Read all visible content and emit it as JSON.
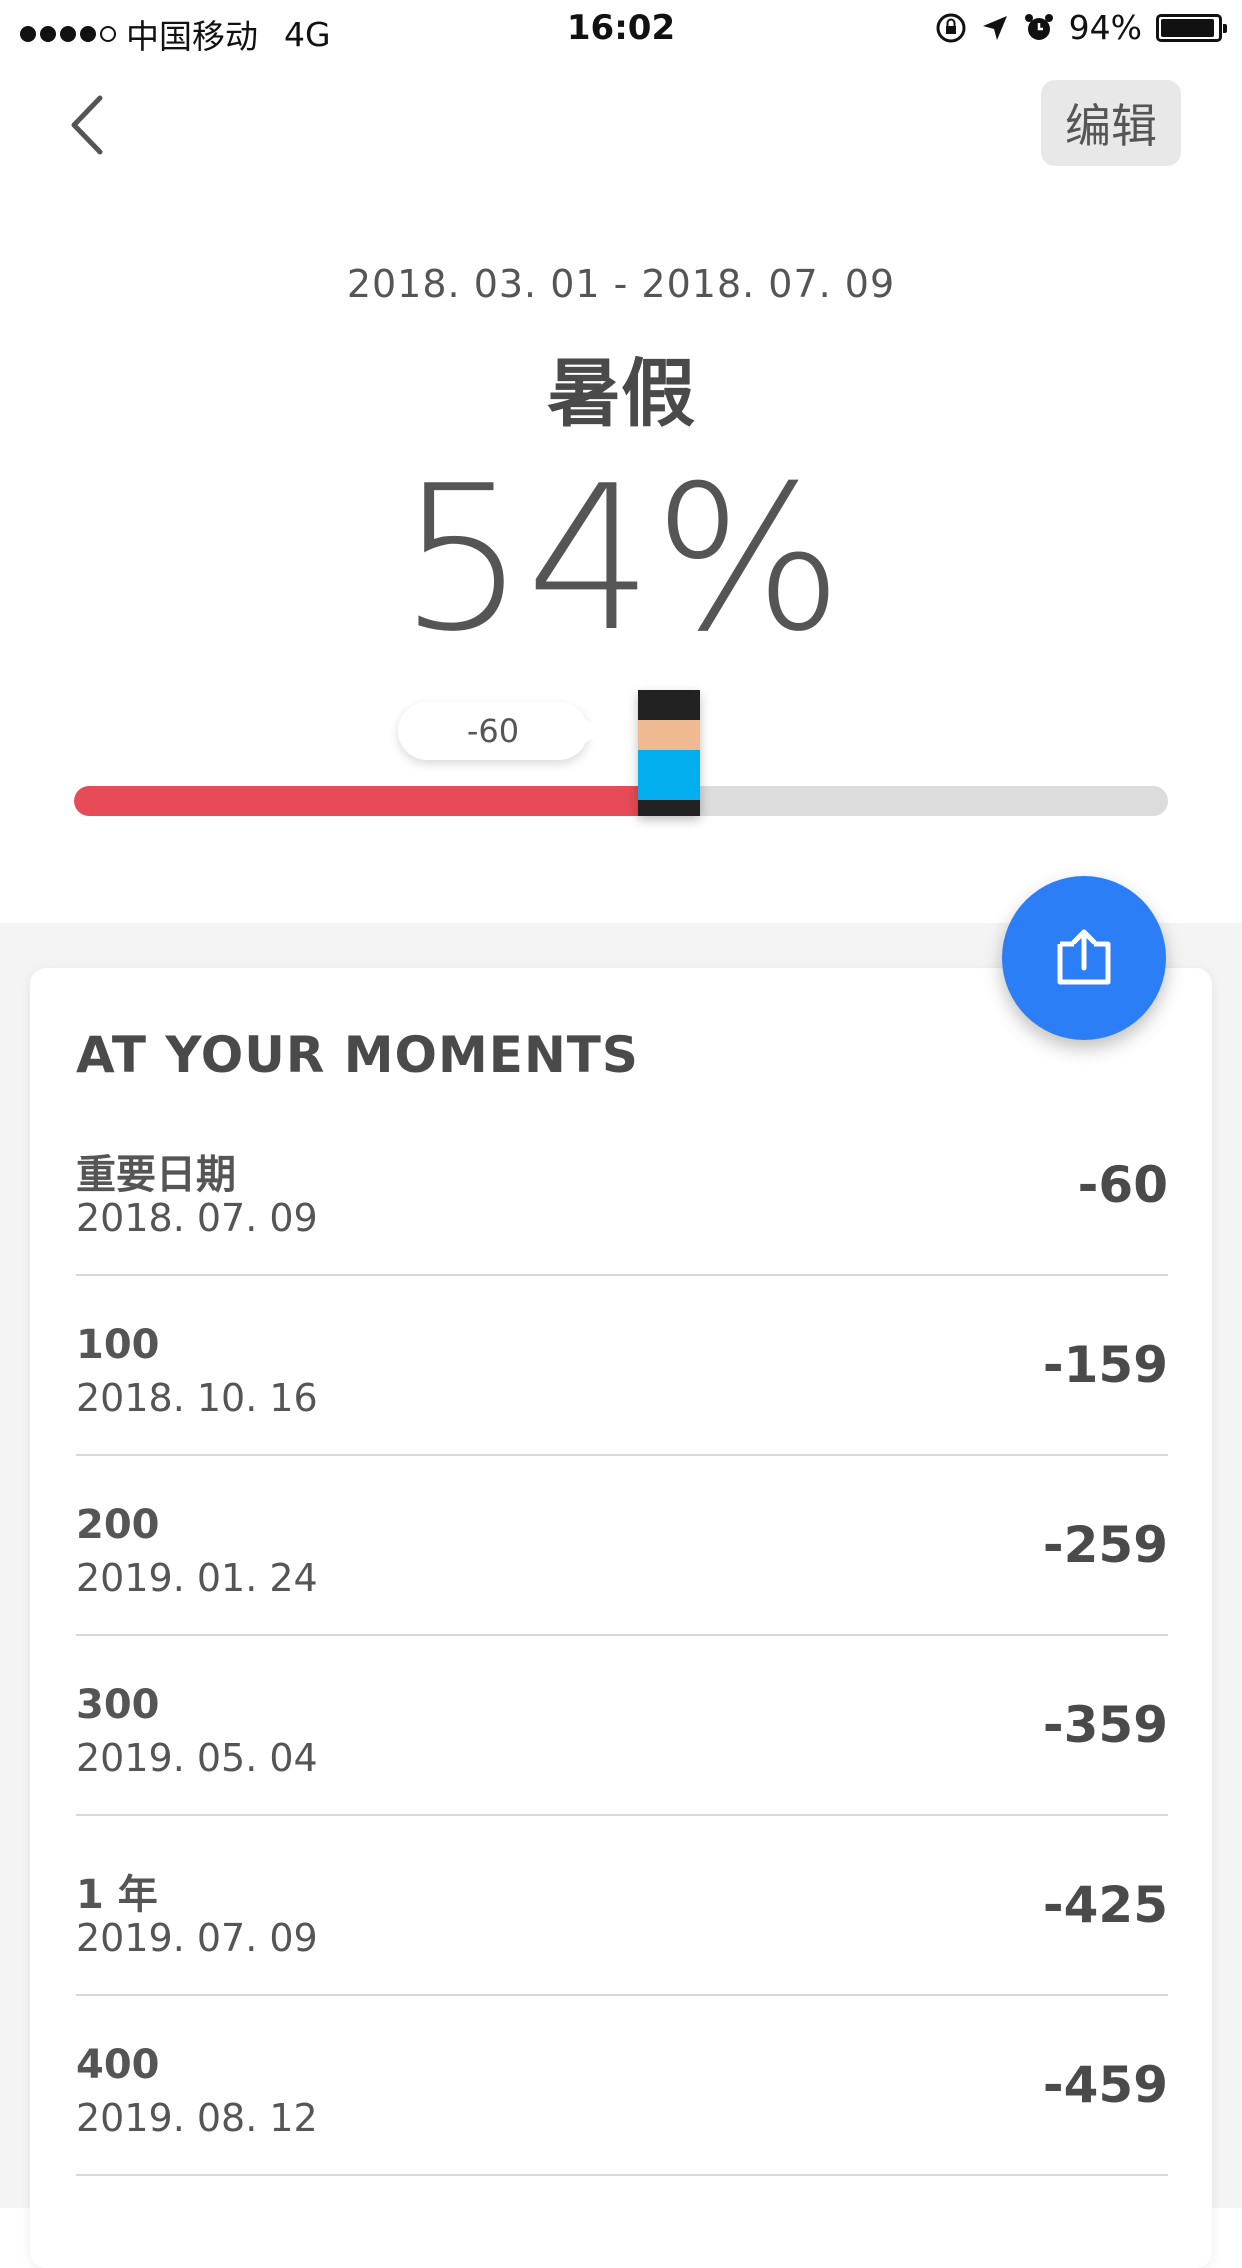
{
  "status_bar": {
    "carrier": "中国移动",
    "network": "4G",
    "time": "16:02",
    "battery": "94%"
  },
  "nav": {
    "back_icon": "chevron-left-icon",
    "edit_label": "编辑"
  },
  "header": {
    "date_range": "2018. 03. 01 - 2018. 07. 09",
    "title": "暑假",
    "percent": "54%"
  },
  "progress": {
    "value_percent": 54,
    "bubble_label": "-60",
    "fill_color": "#e74b58",
    "track_color": "#dcdcdc"
  },
  "moments": {
    "title": "AT YOUR MOMENTS",
    "items": [
      {
        "label": "重要日期",
        "date": "2018. 07. 09",
        "value": "-60"
      },
      {
        "label": "100",
        "date": "2018. 10. 16",
        "value": "-159"
      },
      {
        "label": "200",
        "date": "2019. 01. 24",
        "value": "-259"
      },
      {
        "label": "300",
        "date": "2019. 05. 04",
        "value": "-359"
      },
      {
        "label": "1 年",
        "date": "2019. 07. 09",
        "value": "-425"
      },
      {
        "label": "400",
        "date": "2019. 08. 12",
        "value": "-459"
      }
    ]
  },
  "share": {
    "icon": "share-icon",
    "color": "#2b7ef5"
  }
}
